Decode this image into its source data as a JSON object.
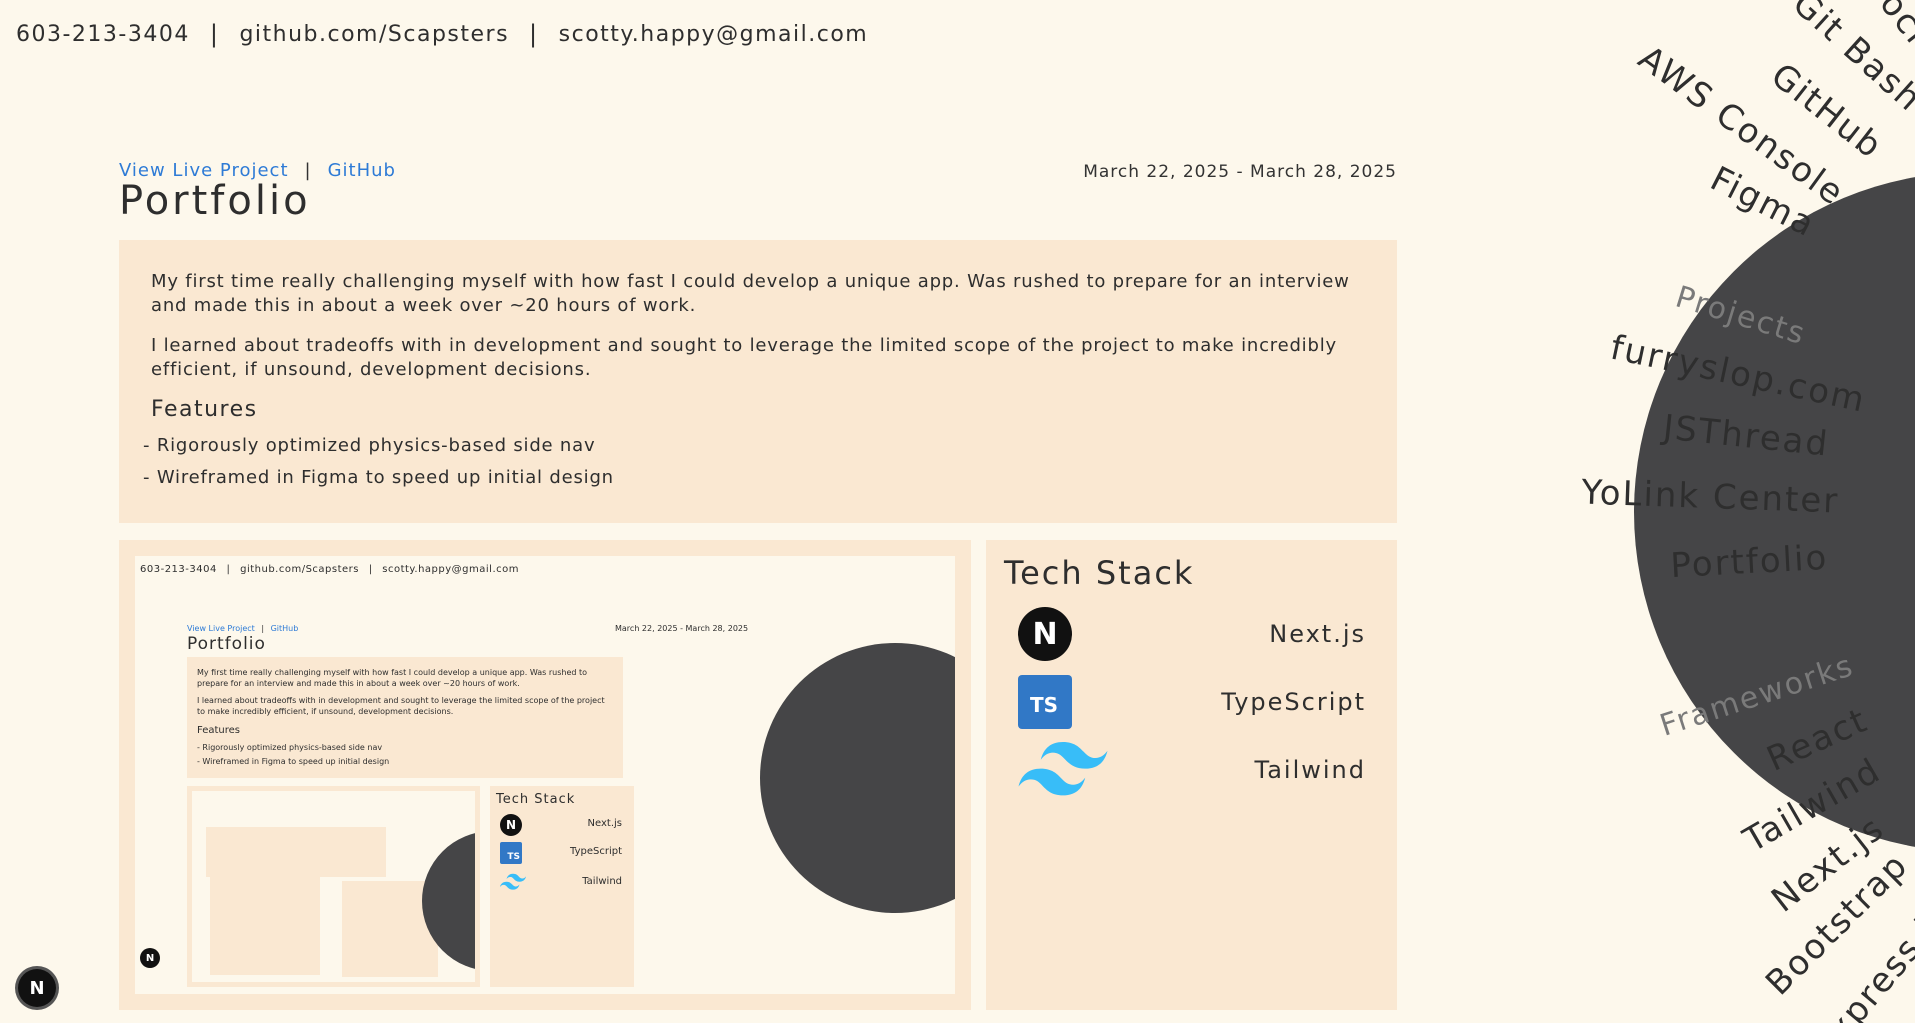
{
  "contact": {
    "phone": "603-213-3404",
    "github": "github.com/Scapsters",
    "email": "scotty.happy@gmail.com",
    "separator": "|"
  },
  "project": {
    "live_link": "View Live Project",
    "github_link": "GitHub",
    "separator": "|",
    "dates": "March 22, 2025 - March 28, 2025",
    "title": "Portfolio",
    "paragraphs": [
      "My first time really challenging myself with how fast I could develop a unique app. Was rushed to prepare for an interview and made this in about a week over ~20 hours of work.",
      "I learned about tradeoffs with in development and sought to leverage the limited scope of the project to make incredibly efficient, if unsound, development decisions."
    ],
    "features_heading": "Features",
    "features": [
      "- Rigorously optimized physics-based side nav",
      "- Wireframed in Figma to speed up initial design"
    ]
  },
  "tech_stack": {
    "heading": "Tech Stack",
    "items": [
      {
        "name": "Next.js",
        "icon": "nextjs-icon",
        "icon_text": "N"
      },
      {
        "name": "TypeScript",
        "icon": "typescript-icon",
        "icon_text": "TS"
      },
      {
        "name": "Tailwind",
        "icon": "tailwind-icon"
      }
    ]
  },
  "side_nav": {
    "tools": [
      "Dock",
      "Git Bash",
      "GitHub",
      "AWS Console",
      "Figma"
    ],
    "projects_heading": "Projects",
    "projects": [
      "furryslop.com",
      "JSThread",
      "YoLink Center",
      "Portfolio"
    ],
    "frameworks_heading": "Frameworks",
    "frameworks": [
      "React",
      "Tailwind",
      "Next.js",
      "Bootstrap",
      "Express.js"
    ]
  },
  "badge": {
    "text": "N"
  },
  "colors": {
    "background": "#fdf8ec",
    "card": "#fae8d2",
    "link": "#2e7bd6",
    "wheel": "#454547",
    "text": "#2e2e2e",
    "muted": "#7a7a7a"
  }
}
